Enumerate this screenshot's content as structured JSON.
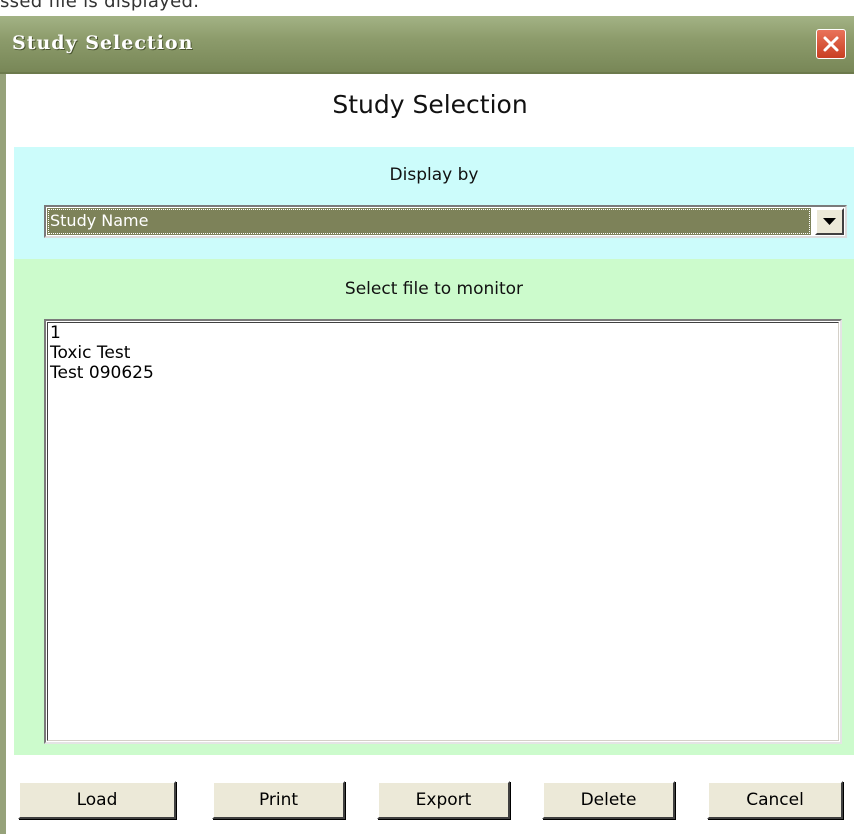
{
  "top_fragment_text": "ssed file is displayed.",
  "window": {
    "title": "Study Selection",
    "close_icon": "close-x-icon"
  },
  "heading": "Study Selection",
  "display_by": {
    "label": "Display by",
    "selected": "Study Name",
    "arrow_icon": "chevron-down-icon"
  },
  "file_list": {
    "label": "Select file to monitor",
    "items": [
      "1",
      "Toxic Test",
      "Test 090625"
    ]
  },
  "buttons": {
    "load": "Load",
    "print": "Print",
    "export": "Export",
    "delete": "Delete",
    "cancel": "Cancel"
  },
  "colors": {
    "titlebar": "#8d9c6c",
    "close_button": "#d5512f",
    "display_section_bg": "#ccfcfb",
    "file_section_bg": "#ccfbcc",
    "selected_value_bg": "#7d8259",
    "button_face": "#ece9d8"
  }
}
